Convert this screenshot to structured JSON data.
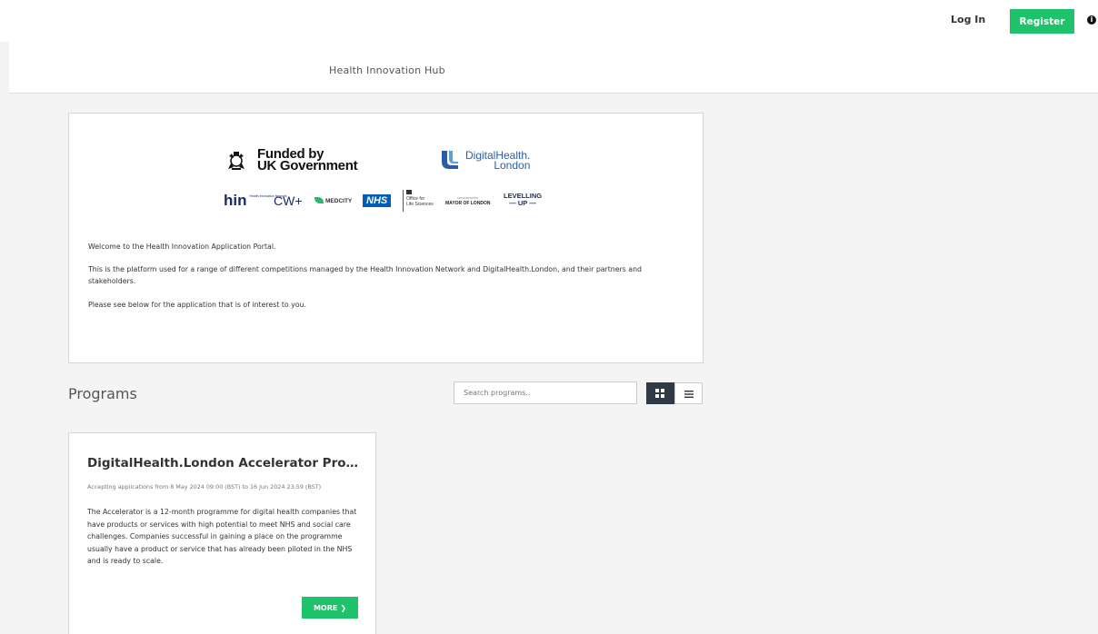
{
  "topbar": {
    "login_label": "Log In",
    "register_label": "Register",
    "info_glyph": "i"
  },
  "header": {
    "site_title": "Health Innovation Hub"
  },
  "welcome": {
    "logos": {
      "ukgov_line1": "Funded by",
      "ukgov_line2": "UK Government",
      "dhl_line1": "DigitalHealth.",
      "dhl_line2": "London",
      "partners": {
        "hin": "hin",
        "hin_small": "Health Innovation Network",
        "cw": "CW+",
        "medcity": "MEDCITY",
        "nhs": "NHS",
        "ols_line1": "Office for",
        "ols_line2": "Life Sciences",
        "mol_sup": "SUPPORTED BY",
        "mol": "MAYOR OF LONDON",
        "lu_line1": "LEVELLING",
        "lu_line2": "UP"
      }
    },
    "para1": "Welcome to the Health Innovation Application Portal.",
    "para2": "This is the platform used for a range of different competitions managed by the Health Innovation Network and DigitalHealth.London, and their partners and stakeholders.",
    "para3": "Please see below for the application that is of interest to you."
  },
  "programs": {
    "title": "Programs",
    "search_placeholder": "Search programs..",
    "cards": [
      {
        "title": "DigitalHealth.London Accelerator Programme",
        "dates": "Accepting applications from 8 May 2024 09:00 (BST) to 16 Jun 2024 23:59 (BST)",
        "description": "The Accelerator is a 12-month programme for digital health companies that have products or services with high potential to meet NHS and social care challenges. Companies successful in gaining a place on the programme usually have a product or service that has already been piloted in the NHS and is ready to scale.",
        "more_label": "MORE"
      }
    ]
  },
  "colors": {
    "accent_green": "#1ec26b",
    "dark_toggle": "#2e3a45",
    "nhs_blue": "#005eb8",
    "dhl_blue": "#2b5ea7"
  }
}
